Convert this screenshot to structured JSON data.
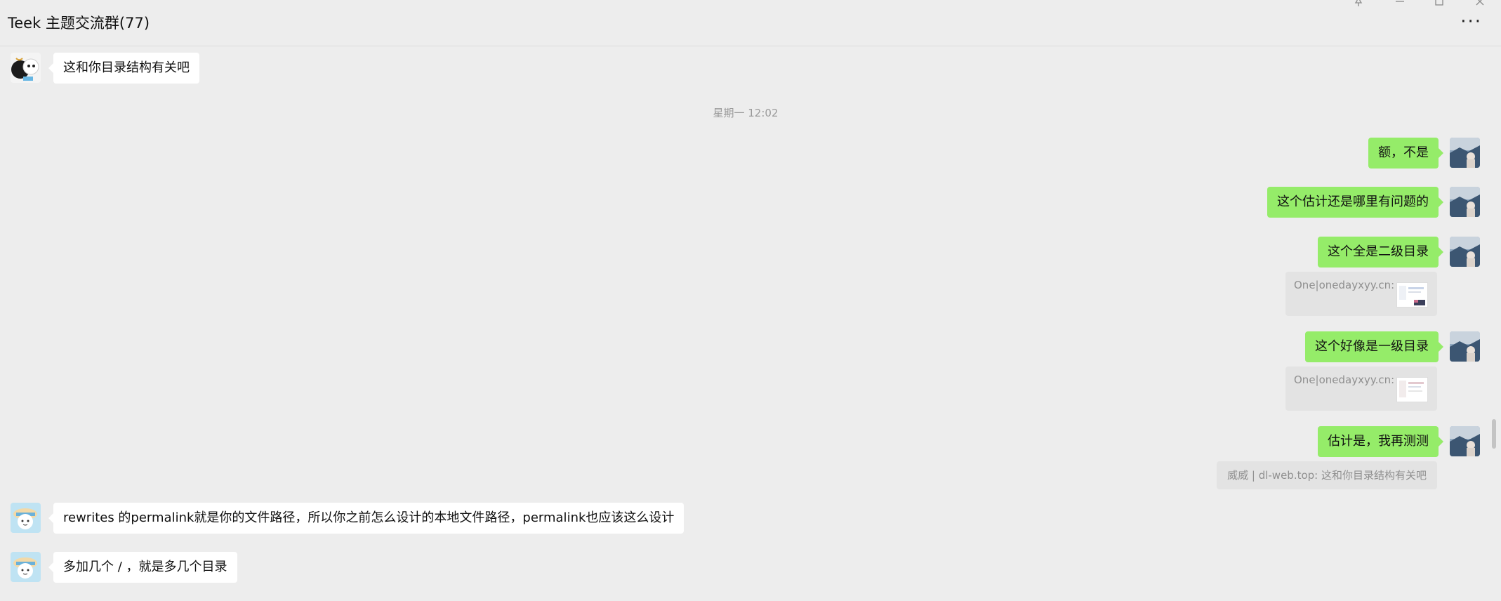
{
  "window": {
    "title": "Teek 主题交流群(77)",
    "more_icon": "more-dots-icon"
  },
  "colors": {
    "background": "#ededed",
    "outgoing_bubble": "#95ec69",
    "incoming_bubble": "#ffffff",
    "quote_bg": "#e3e3e3"
  },
  "messages": {
    "m1": "这和你目录结构有关吧",
    "time1": "星期一 12:02",
    "m2": "额，不是",
    "m3": "这个估计还是哪里有问题的",
    "m4": "这个全是二级目录",
    "q4": "One|onedayxyy.cn:",
    "m5": "这个好像是一级目录",
    "q5": "One|onedayxyy.cn:",
    "m6": "估计是，我再测测",
    "q6": "威威 | dl-web.top: 这和你目录结构有关吧",
    "m7": "rewrites 的permalink就是你的文件路径，所以你之前怎么设计的本地文件路径，permalink也应该这么设计",
    "m8": "多加几个 / ，就是多几个目录"
  }
}
